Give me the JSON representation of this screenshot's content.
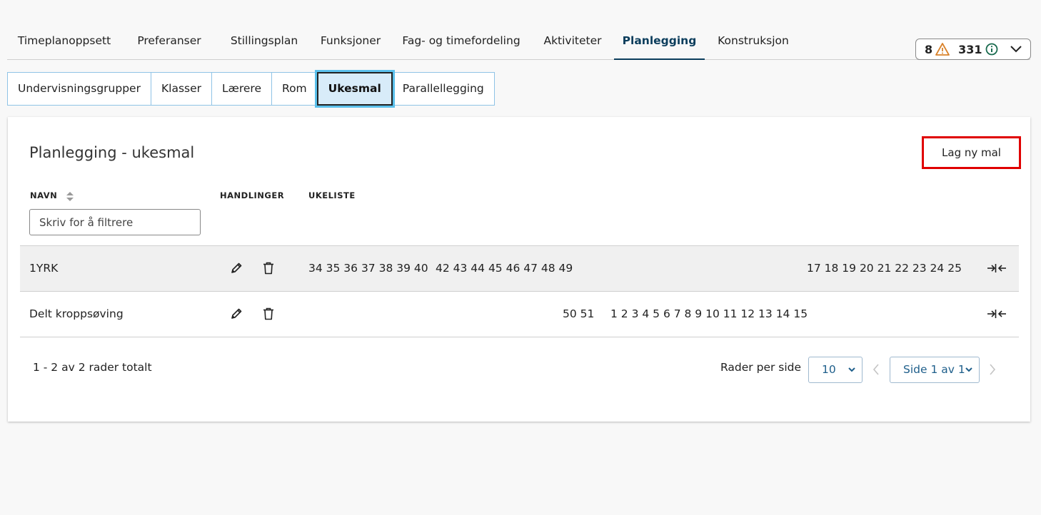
{
  "nav": {
    "tabs": [
      {
        "label": "Timeplanoppsett"
      },
      {
        "label": "Preferanser"
      },
      {
        "label": "Stillingsplan"
      },
      {
        "label": "Funksjoner"
      },
      {
        "label": "Fag- og timefordeling"
      },
      {
        "label": "Aktiviteter"
      },
      {
        "label": "Planlegging"
      },
      {
        "label": "Konstruksjon"
      }
    ],
    "active": "Planlegging"
  },
  "status": {
    "warnings": "8",
    "infos": "331",
    "warning_color": "#d9822b",
    "info_color": "#1a6b4f"
  },
  "subtabs": {
    "items": [
      {
        "label": "Undervisningsgrupper"
      },
      {
        "label": "Klasser"
      },
      {
        "label": "Lærere"
      },
      {
        "label": "Rom"
      },
      {
        "label": "Ukesmal"
      },
      {
        "label": "Parallellegging"
      }
    ],
    "active": "Ukesmal"
  },
  "card": {
    "title": "Planlegging - ukesmal",
    "new_button": "Lag ny mal"
  },
  "table": {
    "headers": {
      "name": "NAVN",
      "actions": "HANDLINGER",
      "weeklist": "UKELISTE"
    },
    "filter_placeholder": "Skriv for å filtrere",
    "rows": [
      {
        "name": "1YRK",
        "weeks_a": "34 35 36 37 38 39 40",
        "weeks_b": "42 43 44 45 46 47 48 49",
        "weeks_c": "",
        "weeks_d": "",
        "weeks_e": "17 18 19 20 21 22 23 24 25"
      },
      {
        "name": "Delt kroppsøving",
        "weeks_a": "",
        "weeks_b": "",
        "weeks_c": "50 51",
        "weeks_d": "1 2 3 4 5 6 7 8 9 10 11 12 13 14 15",
        "weeks_e": ""
      }
    ]
  },
  "footer": {
    "summary": "1 - 2 av 2 rader totalt",
    "rows_per_page_label": "Rader per side",
    "rows_per_page_value": "10",
    "page_value": "Side 1 av 1"
  },
  "icons": {
    "edit": "pencil-icon",
    "delete": "trash-icon",
    "collapse": "collapse-arrows-icon",
    "sort": "sort-icon",
    "dropdown": "chevron-down-icon",
    "prev": "chevron-left-icon",
    "next": "chevron-right-icon"
  }
}
